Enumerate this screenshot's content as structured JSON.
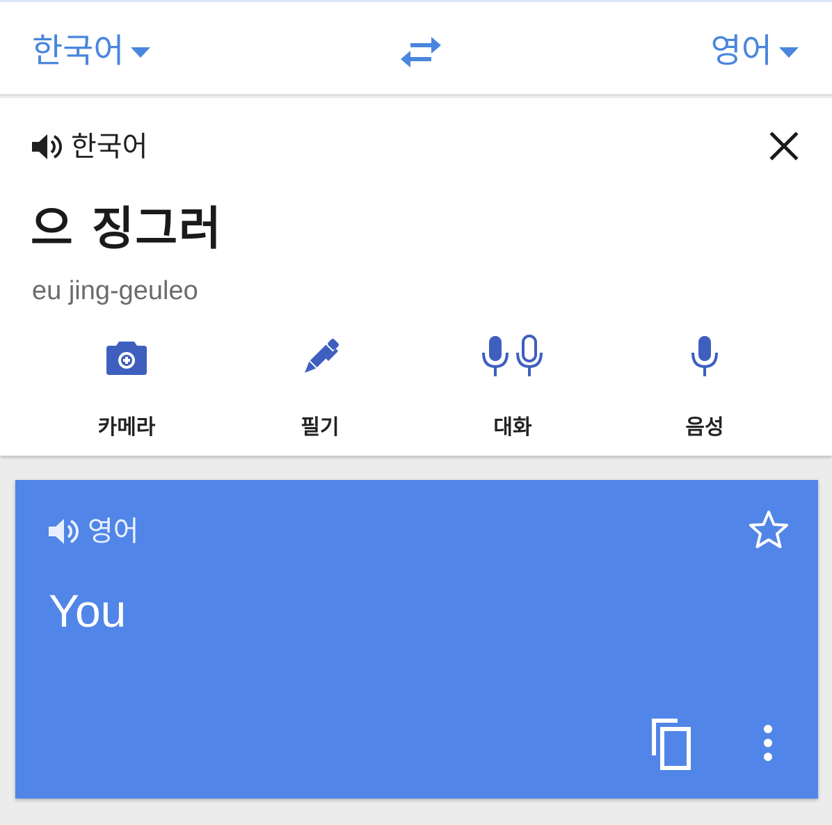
{
  "colors": {
    "accent": "#4a86dd",
    "tool_icon": "#3f5fbf",
    "result_background": "#5185e8",
    "page_background": "#ececec"
  },
  "language_bar": {
    "source_language": "한국어",
    "target_language": "영어",
    "swap_icon": "swap-arrows-icon"
  },
  "input": {
    "language_label": "한국어",
    "speaker_icon": "speaker-icon",
    "clear_icon": "close-icon",
    "text": "으 징그러",
    "romanization": "eu jing-geuleo",
    "tools": [
      {
        "label": "카메라",
        "icon": "camera-icon"
      },
      {
        "label": "필기",
        "icon": "pen-icon"
      },
      {
        "label": "대화",
        "icon": "dual-microphone-icon"
      },
      {
        "label": "음성",
        "icon": "microphone-icon"
      }
    ]
  },
  "result": {
    "language_label": "영어",
    "speaker_icon": "speaker-icon",
    "star_icon": "star-outline-icon",
    "text": "You",
    "copy_icon": "copy-icon",
    "more_icon": "more-vertical-icon"
  }
}
